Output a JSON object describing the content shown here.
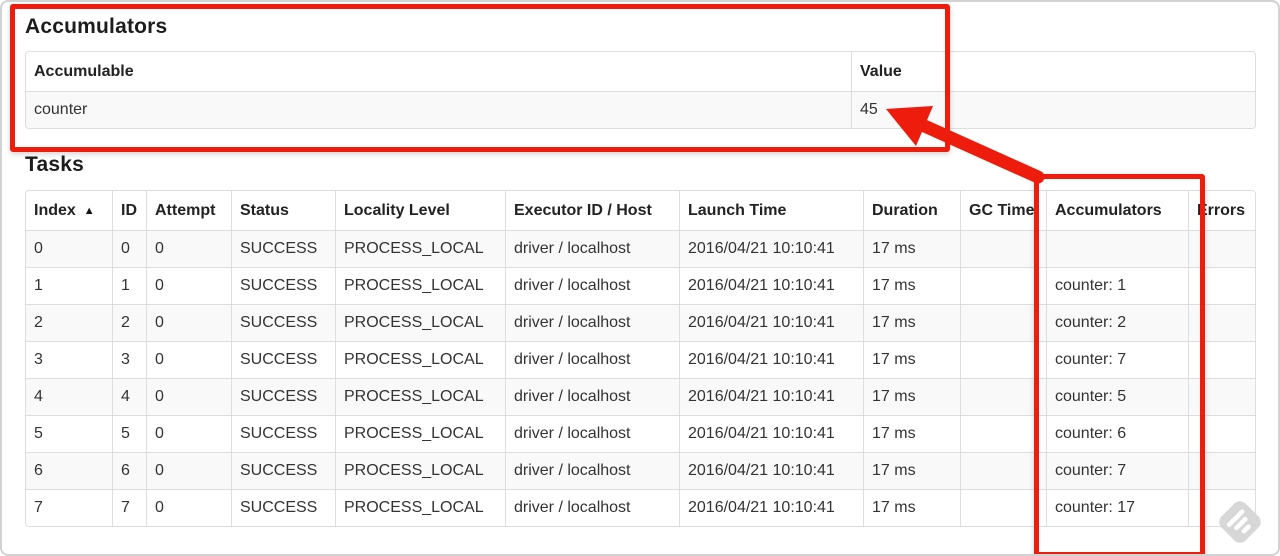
{
  "accumulators": {
    "title": "Accumulators",
    "headers": [
      "Accumulable",
      "Value"
    ],
    "rows": [
      [
        "counter",
        "45"
      ]
    ]
  },
  "tasks": {
    "title": "Tasks",
    "headers": [
      "Index",
      "ID",
      "Attempt",
      "Status",
      "Locality Level",
      "Executor ID / Host",
      "Launch Time",
      "Duration",
      "GC Time",
      "Accumulators",
      "Errors"
    ],
    "sort": {
      "column": "Index",
      "direction": "asc",
      "icon": "▲"
    },
    "rows": [
      [
        "0",
        "0",
        "0",
        "SUCCESS",
        "PROCESS_LOCAL",
        "driver / localhost",
        "2016/04/21 10:10:41",
        "17 ms",
        "",
        "",
        ""
      ],
      [
        "1",
        "1",
        "0",
        "SUCCESS",
        "PROCESS_LOCAL",
        "driver / localhost",
        "2016/04/21 10:10:41",
        "17 ms",
        "",
        "counter: 1",
        ""
      ],
      [
        "2",
        "2",
        "0",
        "SUCCESS",
        "PROCESS_LOCAL",
        "driver / localhost",
        "2016/04/21 10:10:41",
        "17 ms",
        "",
        "counter: 2",
        ""
      ],
      [
        "3",
        "3",
        "0",
        "SUCCESS",
        "PROCESS_LOCAL",
        "driver / localhost",
        "2016/04/21 10:10:41",
        "17 ms",
        "",
        "counter: 7",
        ""
      ],
      [
        "4",
        "4",
        "0",
        "SUCCESS",
        "PROCESS_LOCAL",
        "driver / localhost",
        "2016/04/21 10:10:41",
        "17 ms",
        "",
        "counter: 5",
        ""
      ],
      [
        "5",
        "5",
        "0",
        "SUCCESS",
        "PROCESS_LOCAL",
        "driver / localhost",
        "2016/04/21 10:10:41",
        "17 ms",
        "",
        "counter: 6",
        ""
      ],
      [
        "6",
        "6",
        "0",
        "SUCCESS",
        "PROCESS_LOCAL",
        "driver / localhost",
        "2016/04/21 10:10:41",
        "17 ms",
        "",
        "counter: 7",
        ""
      ],
      [
        "7",
        "7",
        "0",
        "SUCCESS",
        "PROCESS_LOCAL",
        "driver / localhost",
        "2016/04/21 10:10:41",
        "17 ms",
        "",
        "counter: 17",
        ""
      ]
    ]
  },
  "annotations": {
    "color": "#ee1c0c",
    "boxed_regions": [
      "accumulators-section",
      "tasks-accumulators-column"
    ],
    "arrow_points_to": "45"
  },
  "colors": {
    "table_border": "#dddddd",
    "row_stripe": "#f9f9f9",
    "text": "#333333"
  },
  "icons": {
    "watermark": "annotation-tool-watermark",
    "sort_asc": "▲"
  }
}
